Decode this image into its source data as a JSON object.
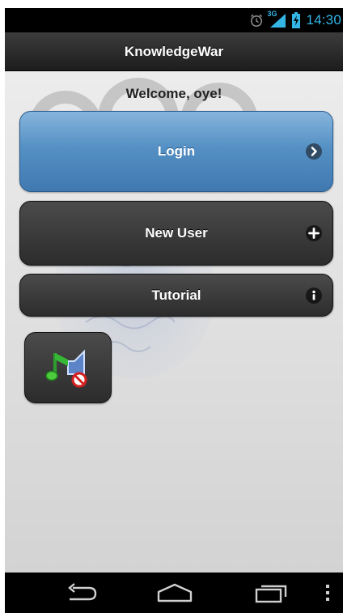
{
  "status_bar": {
    "time": "14:30",
    "network": "3G",
    "icons": [
      "alarm-icon",
      "signal-icon",
      "battery-charging-icon"
    ]
  },
  "header": {
    "title": "KnowledgeWar"
  },
  "main": {
    "welcome": "Welcome, oye!",
    "buttons": [
      {
        "label": "Login",
        "icon": "chevron-right-icon"
      },
      {
        "label": "New User",
        "icon": "plus-icon"
      },
      {
        "label": "Tutorial",
        "icon": "info-icon"
      }
    ],
    "sound_toggle": {
      "icon": "music-muted-icon"
    }
  },
  "nav_bar": {
    "icons": [
      "back-icon",
      "home-icon",
      "recent-apps-icon",
      "menu-icon"
    ]
  },
  "colors": {
    "status_accent": "#33b5e5",
    "login_blue": "#5590c4",
    "dark_button": "#2c2c2c",
    "background": "#d3d3d3"
  }
}
